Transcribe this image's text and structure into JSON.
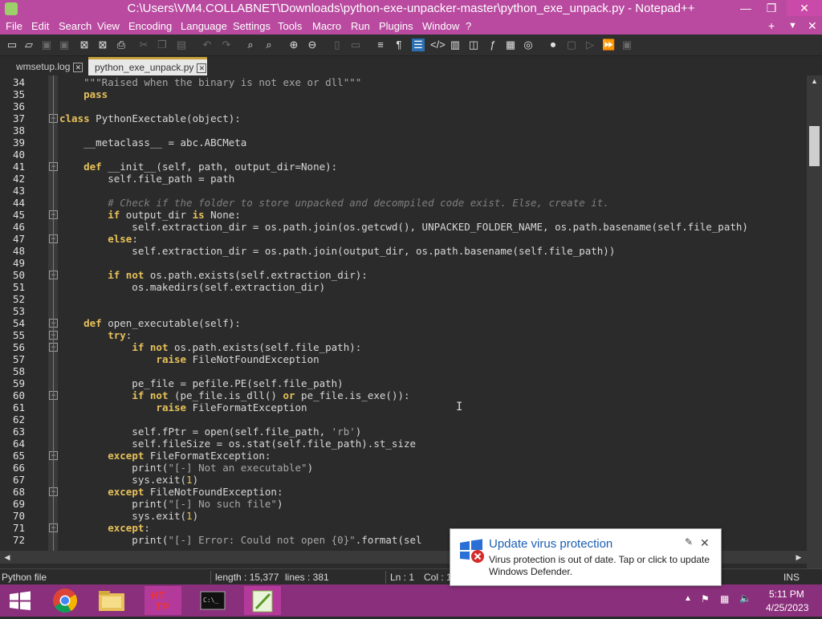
{
  "window": {
    "title": "C:\\Users\\VM4.COLLABNET\\Downloads\\python-exe-unpacker-master\\python_exe_unpack.py - Notepad++"
  },
  "menu": {
    "items": [
      "File",
      "Edit",
      "Search",
      "View",
      "Encoding",
      "Language",
      "Settings",
      "Tools",
      "Macro",
      "Run",
      "Plugins",
      "Window",
      "?"
    ],
    "right": [
      "+",
      "▼",
      "✕"
    ]
  },
  "tabs": [
    {
      "label": "wmsetup.log",
      "selected": false
    },
    {
      "label": "python_exe_unpack.py",
      "selected": true
    }
  ],
  "editor": {
    "lines": [
      {
        "n": "34",
        "code": [
          [
            "",
            "    "
          ],
          [
            "st",
            "\"\"\"Raised when the binary is not exe or dll\"\"\""
          ]
        ]
      },
      {
        "n": "35",
        "code": [
          [
            "",
            "    "
          ],
          [
            "kw",
            "pass"
          ]
        ]
      },
      {
        "n": "36",
        "code": []
      },
      {
        "n": "37",
        "code": [
          [
            "kw",
            "class"
          ],
          [
            "",
            " PythonExectable(object):"
          ]
        ]
      },
      {
        "n": "38",
        "code": []
      },
      {
        "n": "39",
        "code": [
          [
            "",
            "    __metaclass__ = abc.ABCMeta"
          ]
        ]
      },
      {
        "n": "40",
        "code": []
      },
      {
        "n": "41",
        "code": [
          [
            "",
            "    "
          ],
          [
            "kw",
            "def"
          ],
          [
            "",
            " __init__(self, path, output_dir=None):"
          ]
        ]
      },
      {
        "n": "42",
        "code": [
          [
            "",
            "        self.file_path = path"
          ]
        ]
      },
      {
        "n": "43",
        "code": []
      },
      {
        "n": "44",
        "code": [
          [
            "",
            "        "
          ],
          [
            "cm",
            "# Check if the folder to store unpacked and decompiled code exist. Else, create it."
          ]
        ]
      },
      {
        "n": "45",
        "code": [
          [
            "",
            "        "
          ],
          [
            "kw",
            "if"
          ],
          [
            "",
            " output_dir "
          ],
          [
            "kw",
            "is"
          ],
          [
            "",
            " None:"
          ]
        ]
      },
      {
        "n": "46",
        "code": [
          [
            "",
            "            self.extraction_dir = os.path.join(os.getcwd(), UNPACKED_FOLDER_NAME, os.path.basename(self.file_path)"
          ]
        ]
      },
      {
        "n": "47",
        "code": [
          [
            "",
            "        "
          ],
          [
            "kw",
            "else"
          ],
          [
            "",
            ":"
          ]
        ]
      },
      {
        "n": "48",
        "code": [
          [
            "",
            "            self.extraction_dir = os.path.join(output_dir, os.path.basename(self.file_path))"
          ]
        ]
      },
      {
        "n": "49",
        "code": []
      },
      {
        "n": "50",
        "code": [
          [
            "",
            "        "
          ],
          [
            "kw",
            "if not"
          ],
          [
            "",
            " os.path.exists(self.extraction_dir):"
          ]
        ]
      },
      {
        "n": "51",
        "code": [
          [
            "",
            "            os.makedirs(self.extraction_dir)"
          ]
        ]
      },
      {
        "n": "52",
        "code": []
      },
      {
        "n": "53",
        "code": []
      },
      {
        "n": "54",
        "code": [
          [
            "",
            "    "
          ],
          [
            "kw",
            "def"
          ],
          [
            "",
            " open_executable(self):"
          ]
        ]
      },
      {
        "n": "55",
        "code": [
          [
            "",
            "        "
          ],
          [
            "kw",
            "try"
          ],
          [
            "",
            ":"
          ]
        ]
      },
      {
        "n": "56",
        "code": [
          [
            "",
            "            "
          ],
          [
            "kw",
            "if not"
          ],
          [
            "",
            " os.path.exists(self.file_path):"
          ]
        ]
      },
      {
        "n": "57",
        "code": [
          [
            "",
            "                "
          ],
          [
            "kw",
            "raise"
          ],
          [
            "",
            " FileNotFoundException"
          ]
        ]
      },
      {
        "n": "58",
        "code": []
      },
      {
        "n": "59",
        "code": [
          [
            "",
            "            pe_file = pefile.PE(self.file_path)"
          ]
        ]
      },
      {
        "n": "60",
        "code": [
          [
            "",
            "            "
          ],
          [
            "kw",
            "if not"
          ],
          [
            "",
            " (pe_file.is_dll() "
          ],
          [
            "kw",
            "or"
          ],
          [
            "",
            " pe_file.is_exe()):"
          ]
        ]
      },
      {
        "n": "61",
        "code": [
          [
            "",
            "                "
          ],
          [
            "kw",
            "raise"
          ],
          [
            "",
            " FileFormatException"
          ]
        ]
      },
      {
        "n": "62",
        "code": []
      },
      {
        "n": "63",
        "code": [
          [
            "",
            "            self.fPtr = open(self.file_path, "
          ],
          [
            "st",
            "'rb'"
          ],
          [
            "",
            ")"
          ]
        ]
      },
      {
        "n": "64",
        "code": [
          [
            "",
            "            self.fileSize = os.stat(self.file_path).st_size"
          ]
        ]
      },
      {
        "n": "65",
        "code": [
          [
            "",
            "        "
          ],
          [
            "kw",
            "except"
          ],
          [
            "",
            " FileFormatException:"
          ]
        ]
      },
      {
        "n": "66",
        "code": [
          [
            "",
            "            print("
          ],
          [
            "st",
            "\"[-] Not an executable\""
          ],
          [
            "",
            ")"
          ]
        ]
      },
      {
        "n": "67",
        "code": [
          [
            "",
            "            sys.exit("
          ],
          [
            "num",
            "1"
          ],
          [
            "",
            ")"
          ]
        ]
      },
      {
        "n": "68",
        "code": [
          [
            "",
            "        "
          ],
          [
            "kw",
            "except"
          ],
          [
            "",
            " FileNotFoundException:"
          ]
        ]
      },
      {
        "n": "69",
        "code": [
          [
            "",
            "            print("
          ],
          [
            "st",
            "\"[-] No such file\""
          ],
          [
            "",
            ")"
          ]
        ]
      },
      {
        "n": "70",
        "code": [
          [
            "",
            "            sys.exit("
          ],
          [
            "num",
            "1"
          ],
          [
            "",
            ")"
          ]
        ]
      },
      {
        "n": "71",
        "code": [
          [
            "",
            "        "
          ],
          [
            "kw",
            "except"
          ],
          [
            "",
            ":"
          ]
        ]
      },
      {
        "n": "72",
        "code": [
          [
            "",
            "            print("
          ],
          [
            "st",
            "\"[-] Error: Could not open {0}\""
          ],
          [
            "",
            ".format(sel"
          ]
        ]
      }
    ]
  },
  "status": {
    "type": "Python file",
    "length": "length : 15,377",
    "lines": "lines : 381",
    "ln": "Ln : 1",
    "col": "Col : 1",
    "ins": "INS"
  },
  "toast": {
    "title": "Update virus protection",
    "body": "Virus protection is out of date. Tap or click to update Windows Defender."
  },
  "clock": {
    "time": "5:11 PM",
    "date": "4/25/2023"
  },
  "colors": {
    "accent": "#b94aa0",
    "taskbar": "#8a2f7b",
    "keyword": "#e6c15a"
  }
}
